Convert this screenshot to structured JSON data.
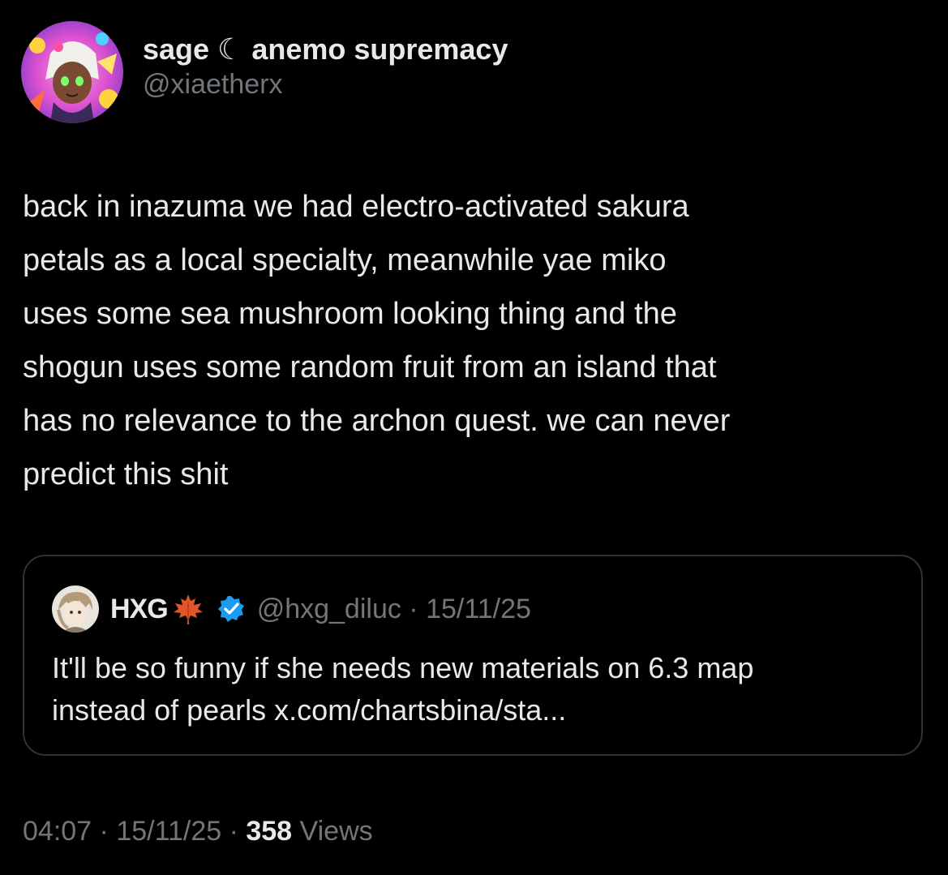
{
  "author": {
    "display_name": "sage ☾ anemo supremacy",
    "handle": "@xiaetherx",
    "avatar_icon": "anime-character-avatar"
  },
  "tweet": {
    "text": "back in inazuma we had electro-activated sakura\npetals as a local specialty, meanwhile yae miko\nuses some sea mushroom looking thing and the\nshogun uses some random fruit from an island that\nhas no relevance to the archon quest. we can never\npredict this shit"
  },
  "quote": {
    "name": "HXG",
    "name_icon": "maple-leaf-icon",
    "verified_icon": "verified-badge-icon",
    "handle": "@hxg_diluc",
    "separator": " · ",
    "date": "15/11/25",
    "text": "It'll be so funny if she needs new materials on 6.3 map\ninstead of pearls x.com/chartsbina/sta..."
  },
  "meta": {
    "time": "04:07",
    "separator": " · ",
    "date": "15/11/25",
    "views_count": "358",
    "views_label": " Views"
  },
  "colors": {
    "background": "#000000",
    "text": "#e7e9ea",
    "muted": "#71767b",
    "border": "#2f3336",
    "verified": "#1d9bf0",
    "leaf": "#e0552a"
  }
}
